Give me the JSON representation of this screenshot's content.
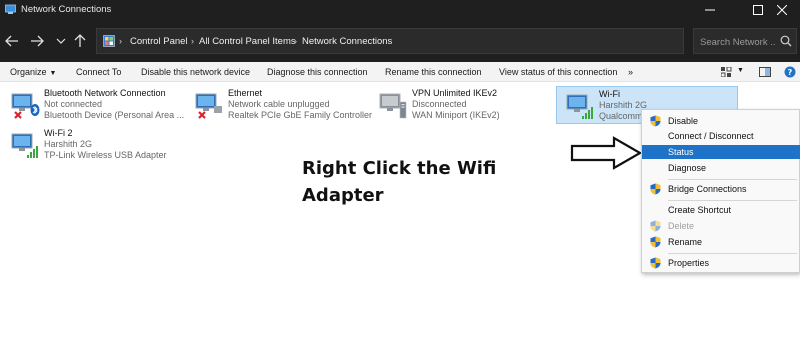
{
  "window": {
    "title": "Network Connections"
  },
  "address": {
    "crumbs": [
      "Control Panel",
      "All Control Panel Items",
      "Network Connections"
    ],
    "search_placeholder": "Search Network ..."
  },
  "commands": {
    "organize": "Organize",
    "connect_to": "Connect To",
    "disable": "Disable this network device",
    "diagnose": "Diagnose this connection",
    "rename": "Rename this connection",
    "view_status": "View status of this connection",
    "more": "»"
  },
  "adapters": [
    {
      "name": "Bluetooth Network Connection",
      "status": "Not connected",
      "device": "Bluetooth Device (Personal Area ...",
      "icon": "bluetooth-adapter-icon"
    },
    {
      "name": "Ethernet",
      "status": "Network cable unplugged",
      "device": "Realtek PCIe GbE Family Controller",
      "icon": "ethernet-adapter-icon"
    },
    {
      "name": "VPN Unlimited IKEv2",
      "status": "Disconnected",
      "device": "WAN Miniport (IKEv2)",
      "icon": "vpn-adapter-icon"
    },
    {
      "name": "Wi-Fi",
      "status": "Harshith 2G",
      "device": "Qualcomm",
      "icon": "wifi-adapter-icon",
      "selected": true
    },
    {
      "name": "Wi-Fi 2",
      "status": "Harshith 2G",
      "device": "TP-Link Wireless USB Adapter",
      "icon": "wifi-adapter-icon"
    }
  ],
  "annotation": {
    "line1": "Right Click the Wifi",
    "line2": "Adapter"
  },
  "context_menu": {
    "items": [
      {
        "label": "Disable",
        "shield": true,
        "disabled": false
      },
      {
        "label": "Connect / Disconnect",
        "shield": false,
        "disabled": false
      },
      {
        "label": "Status",
        "shield": false,
        "disabled": false,
        "highlighted": true
      },
      {
        "label": "Diagnose",
        "shield": false,
        "disabled": false
      },
      {
        "label": "Bridge Connections",
        "shield": true,
        "disabled": false
      },
      {
        "label": "Create Shortcut",
        "shield": false,
        "disabled": false
      },
      {
        "label": "Delete",
        "shield": true,
        "disabled": true
      },
      {
        "label": "Rename",
        "shield": true,
        "disabled": false
      },
      {
        "label": "Properties",
        "shield": true,
        "disabled": false
      }
    ]
  },
  "colors": {
    "titlebar": "#1f1f1f",
    "selection": "#cce4f7",
    "menu_highlight": "#1e73c8"
  }
}
